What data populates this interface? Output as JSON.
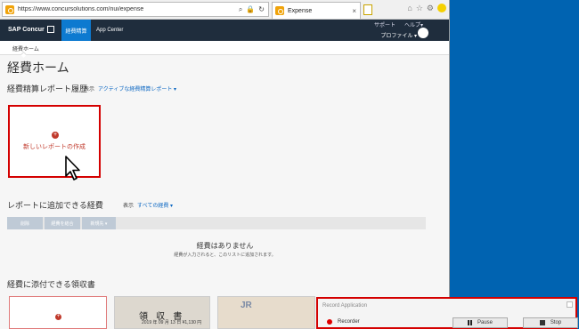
{
  "browser": {
    "url": "https://www.concursolutions.com/nui/expense",
    "tab_title": "Expense"
  },
  "header": {
    "brand": "SAP Concur",
    "nav_active": "経費精算",
    "nav_item": "App Center",
    "links": [
      "サポート",
      "ヘルプ▾"
    ],
    "profile": "プロファイル ▾"
  },
  "breadcrumb": "経費ホーム",
  "page_title": "経費ホーム",
  "reports_section": {
    "title": "経費精算レポート履歴",
    "view_label": "表示",
    "view_value": "アクティブな経費精算レポート ▾",
    "create_card_label": "新しいレポートの作成"
  },
  "expenses_section": {
    "title": "レポートに追加できる経費",
    "view_label": "表示",
    "view_value": "すべての経費 ▾",
    "toolbar": [
      "削除",
      "経費を結合",
      "新規先 ▾"
    ],
    "empty_title": "経費はありません",
    "empty_subtitle": "経費が入力されると、このリストに追加されます。"
  },
  "receipts_section": {
    "title": "経費に添付できる領収書",
    "receipt_title": "領 収 書",
    "receipt_lines": "2019 年 09 月 13 日  ¥1,130 円"
  },
  "recorder": {
    "title": "Record Application",
    "status": "Recorder",
    "pause_label": "Pause",
    "stop_label": "Stop"
  },
  "colors": {
    "header_bg": "#1f2d3d",
    "accent": "#0d7ad0",
    "highlight": "#d40000",
    "desktop": "#0063b1"
  }
}
